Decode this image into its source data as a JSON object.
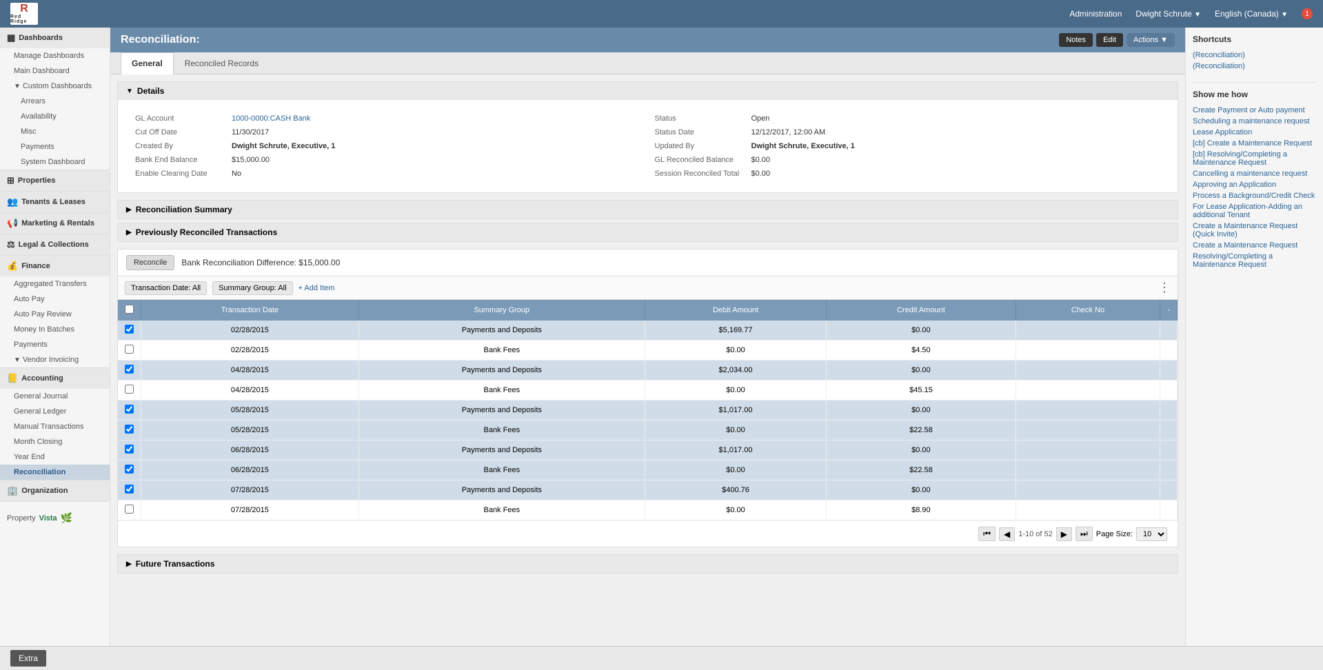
{
  "header": {
    "logo_r": "R",
    "logo_company": "Red Ridge",
    "nav_items": [
      "Administration",
      "Dwight Schrute",
      "English (Canada)"
    ],
    "notification_count": "1"
  },
  "page_title": "Reconciliation:",
  "header_buttons": {
    "notes": "Notes",
    "edit": "Edit",
    "actions": "Actions"
  },
  "tabs": [
    {
      "id": "general",
      "label": "General",
      "active": true
    },
    {
      "id": "reconciled-records",
      "label": "Reconciled Records",
      "active": false
    }
  ],
  "details": {
    "section_title": "Details",
    "fields": {
      "gl_account_label": "GL Account",
      "gl_account_value": "1000-0000:CASH Bank",
      "status_label": "Status",
      "status_value": "Open",
      "cut_off_date_label": "Cut Off Date",
      "cut_off_date_value": "11/30/2017",
      "status_date_label": "Status Date",
      "status_date_value": "12/12/2017, 12:00 AM",
      "created_by_label": "Created By",
      "created_by_value": "Dwight Schrute, Executive, 1",
      "updated_by_label": "Updated By",
      "updated_by_value": "Dwight Schrute, Executive, 1",
      "bank_end_balance_label": "Bank End Balance",
      "bank_end_balance_value": "$15,000.00",
      "gl_reconciled_balance_label": "GL Reconciled Balance",
      "gl_reconciled_balance_value": "$0.00",
      "enable_clearing_date_label": "Enable Clearing Date",
      "enable_clearing_date_value": "No",
      "session_reconciled_total_label": "Session Reconciled Total",
      "session_reconciled_total_value": "$0.00"
    }
  },
  "reconciliation_summary": {
    "title": "Reconciliation Summary"
  },
  "previously_reconciled": {
    "title": "Previously Reconciled Transactions"
  },
  "reconcile_section": {
    "reconcile_btn": "Reconcile",
    "difference_text": "Bank Reconciliation Difference: $15,000.00"
  },
  "table_toolbar": {
    "transaction_date_filter": "Transaction Date: All",
    "summary_group_filter": "Summary Group: All",
    "add_item": "+ Add Item"
  },
  "table": {
    "columns": [
      "",
      "Transaction Date",
      "Summary Group",
      "Debit Amount",
      "Credit Amount",
      "Check No",
      ""
    ],
    "rows": [
      {
        "checked": true,
        "date": "02/28/2015",
        "group": "Payments and Deposits",
        "debit": "$5,169.77",
        "credit": "$0.00",
        "check_no": ""
      },
      {
        "checked": false,
        "date": "02/28/2015",
        "group": "Bank Fees",
        "debit": "$0.00",
        "credit": "$4.50",
        "check_no": ""
      },
      {
        "checked": true,
        "date": "04/28/2015",
        "group": "Payments and Deposits",
        "debit": "$2,034.00",
        "credit": "$0.00",
        "check_no": ""
      },
      {
        "checked": false,
        "date": "04/28/2015",
        "group": "Bank Fees",
        "debit": "$0.00",
        "credit": "$45.15",
        "check_no": ""
      },
      {
        "checked": true,
        "date": "05/28/2015",
        "group": "Payments and Deposits",
        "debit": "$1,017.00",
        "credit": "$0.00",
        "check_no": ""
      },
      {
        "checked": true,
        "date": "05/28/2015",
        "group": "Bank Fees",
        "debit": "$0.00",
        "credit": "$22.58",
        "check_no": ""
      },
      {
        "checked": true,
        "date": "06/28/2015",
        "group": "Payments and Deposits",
        "debit": "$1,017.00",
        "credit": "$0.00",
        "check_no": ""
      },
      {
        "checked": true,
        "date": "06/28/2015",
        "group": "Bank Fees",
        "debit": "$0.00",
        "credit": "$22.58",
        "check_no": ""
      },
      {
        "checked": true,
        "date": "07/28/2015",
        "group": "Payments and Deposits",
        "debit": "$400.76",
        "credit": "$0.00",
        "check_no": ""
      },
      {
        "checked": false,
        "date": "07/28/2015",
        "group": "Bank Fees",
        "debit": "$0.00",
        "credit": "$8.90",
        "check_no": ""
      }
    ]
  },
  "pagination": {
    "info": "1-10 of 52",
    "page_size_label": "Page Size:",
    "page_size": "10"
  },
  "future_transactions": {
    "title": "Future Transactions"
  },
  "shortcuts": {
    "title": "Shortcuts",
    "links": [
      "(Reconciliation)",
      "(Reconciliation)"
    ]
  },
  "show_me_how": {
    "title": "Show me how",
    "links": [
      "Create Payment or Auto payment",
      "Scheduling a maintenance request",
      "Lease Application",
      "[cb] Create a Maintenance Request",
      "[cb] Resolving/Completing a Maintenance Request",
      "Cancelling a maintenance request",
      "Approving an Application",
      "Process a Background/Credit Check",
      "For Lease Application-Adding an additional Tenant",
      "Create a Maintenance Request (Quick Invite)",
      "Create a Maintenance Request",
      "Resolving/Completing a Maintenance Request"
    ]
  },
  "sidebar": {
    "sections": [
      {
        "id": "dashboards",
        "icon": "▦",
        "label": "Dashboards",
        "items": [
          {
            "label": "Manage Dashboards",
            "indent": 1
          },
          {
            "label": "Main Dashboard",
            "indent": 1
          },
          {
            "label": "Custom Dashboards",
            "indent": 1,
            "expandable": true
          },
          {
            "label": "Arrears",
            "indent": 2
          },
          {
            "label": "Availability",
            "indent": 2
          },
          {
            "label": "Misc",
            "indent": 2
          },
          {
            "label": "Payments",
            "indent": 2
          },
          {
            "label": "System Dashboard",
            "indent": 2
          }
        ]
      },
      {
        "id": "properties",
        "icon": "🏠",
        "label": "Properties",
        "items": []
      },
      {
        "id": "tenants-leases",
        "icon": "👥",
        "label": "Tenants & Leases",
        "items": []
      },
      {
        "id": "marketing-rentals",
        "icon": "📢",
        "label": "Marketing & Rentals",
        "items": []
      },
      {
        "id": "legal-collections",
        "icon": "⚖",
        "label": "Legal & Collections",
        "items": []
      },
      {
        "id": "finance",
        "icon": "💰",
        "label": "Finance",
        "items": [
          {
            "label": "Aggregated Transfers",
            "indent": 1
          },
          {
            "label": "Auto Pay",
            "indent": 1
          },
          {
            "label": "Auto Pay Review",
            "indent": 1
          },
          {
            "label": "Money In Batches",
            "indent": 1
          },
          {
            "label": "Payments",
            "indent": 1
          },
          {
            "label": "Vendor Invoicing",
            "indent": 1,
            "expandable": true
          }
        ]
      },
      {
        "id": "accounting",
        "icon": "📒",
        "label": "Accounting",
        "items": [
          {
            "label": "General Journal",
            "indent": 1
          },
          {
            "label": "General Ledger",
            "indent": 1
          },
          {
            "label": "Manual Transactions",
            "indent": 1
          },
          {
            "label": "Month Closing",
            "indent": 1
          },
          {
            "label": "Year End",
            "indent": 1
          },
          {
            "label": "Reconciliation",
            "indent": 1,
            "active": true
          }
        ]
      },
      {
        "id": "organization",
        "icon": "🏢",
        "label": "Organization",
        "items": []
      }
    ]
  },
  "bottom_bar": {
    "extra_btn": "Extra"
  }
}
